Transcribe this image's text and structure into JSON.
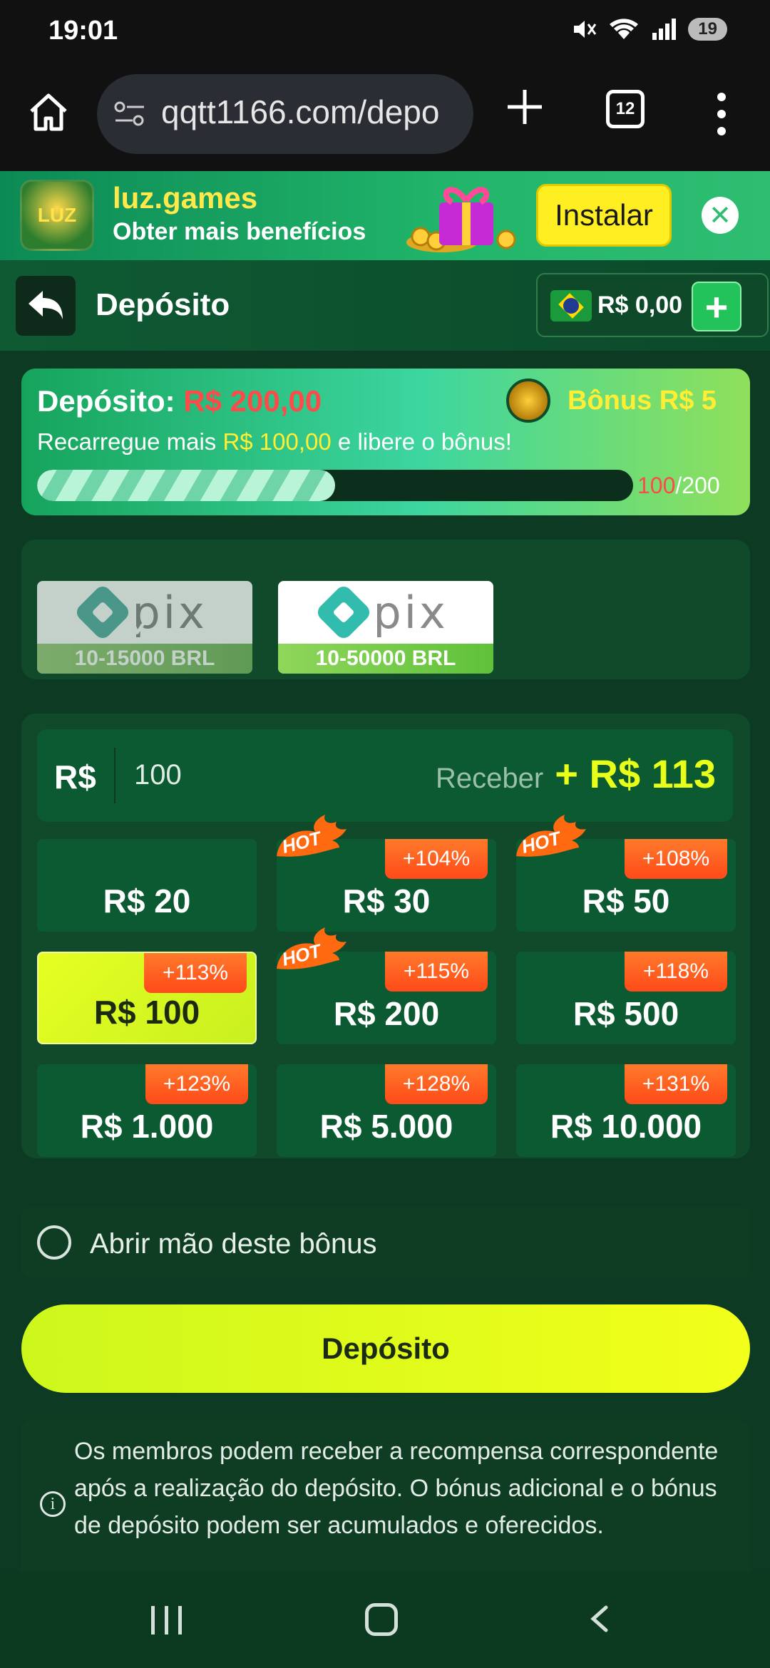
{
  "status": {
    "time": "19:01",
    "battery": "19"
  },
  "browser": {
    "url": "qqtt1166.com/depo",
    "tab_count": "12"
  },
  "app_banner": {
    "name": "luz.games",
    "subtitle": "Obter mais benefícios",
    "install_label": "Instalar",
    "logo_text": "LUZ"
  },
  "header": {
    "title": "Depósito",
    "balance": "R$ 0,00"
  },
  "progress": {
    "label": "Depósito: ",
    "amount": "R$ 200,00",
    "bonus": "Bônus R$ 5",
    "sub_prefix": "Recarregue mais ",
    "sub_amount": "R$ 100,00",
    "sub_suffix": " e libere o bônus!",
    "current": "100",
    "target": "/200",
    "fraction": 0.5
  },
  "payment_methods": [
    {
      "name": "pix",
      "range": "10-15000 BRL",
      "selected": true
    },
    {
      "name": "pix",
      "range": "10-50000 BRL",
      "selected": false
    }
  ],
  "amount": {
    "currency": "R$",
    "value": "100",
    "receive_label": "Receber",
    "receive_value": "+ R$ 113"
  },
  "chips": [
    {
      "value": "R$ 20",
      "badge": "",
      "hot": false,
      "active": false
    },
    {
      "value": "R$ 30",
      "badge": "+104%",
      "hot": true,
      "active": false
    },
    {
      "value": "R$ 50",
      "badge": "+108%",
      "hot": true,
      "active": false
    },
    {
      "value": "R$ 100",
      "badge": "+113%",
      "hot": false,
      "active": true
    },
    {
      "value": "R$ 200",
      "badge": "+115%",
      "hot": true,
      "active": false
    },
    {
      "value": "R$ 500",
      "badge": "+118%",
      "hot": false,
      "active": false
    },
    {
      "value": "R$ 1.000",
      "badge": "+123%",
      "hot": false,
      "active": false
    },
    {
      "value": "R$ 5.000",
      "badge": "+128%",
      "hot": false,
      "active": false
    },
    {
      "value": "R$ 10.000",
      "badge": "+131%",
      "hot": false,
      "active": false
    }
  ],
  "hot_label": "HOT",
  "optout_label": "Abrir mão deste bônus",
  "deposit_button": "Depósito",
  "info_text": "Os membros podem receber a recompensa correspondente após a realização do depósito. O bónus adicional e o bónus de depósito podem ser acumulados e oferecidos.",
  "colors": {
    "accent": "#e8ff1a",
    "bg": "#0d3a22",
    "badge": "#ff5a1f",
    "highlight_red": "#ff4a4a"
  }
}
